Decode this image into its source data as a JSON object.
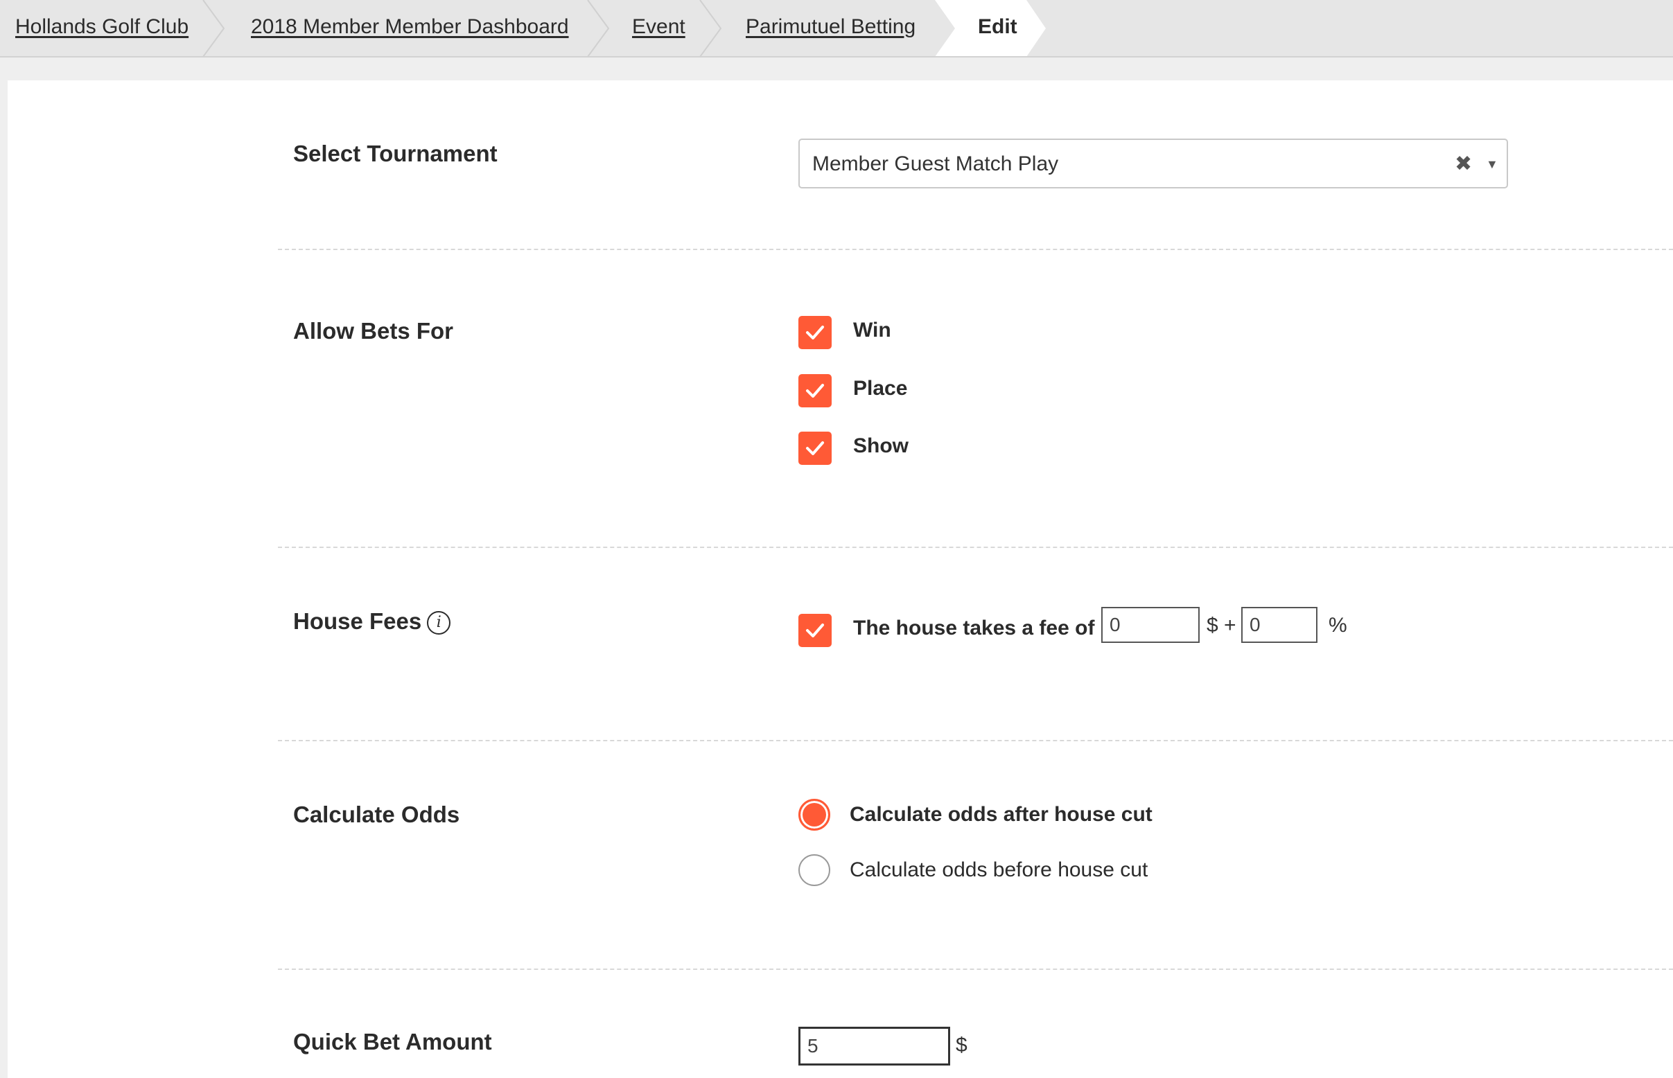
{
  "breadcrumb": {
    "items": [
      "Hollands Golf Club",
      "2018 Member Member Dashboard",
      "Event",
      "Parimutuel Betting"
    ],
    "active": "Edit"
  },
  "tournament": {
    "label": "Select Tournament",
    "value": "Member Guest Match Play",
    "clear": "✖",
    "caret": "▼"
  },
  "bets": {
    "label": "Allow Bets For",
    "options": [
      {
        "label": "Win",
        "checked": true
      },
      {
        "label": "Place",
        "checked": true
      },
      {
        "label": "Show",
        "checked": true
      }
    ]
  },
  "house_fees": {
    "label": "House Fees",
    "info": "i",
    "checked": true,
    "text": "The house takes a fee of",
    "fixed_value": "0",
    "fixed_unit": "$ +",
    "percent_value": "0",
    "percent_unit": "%"
  },
  "odds": {
    "label": "Calculate Odds",
    "options": [
      {
        "label": "Calculate odds after house cut",
        "selected": true
      },
      {
        "label": "Calculate odds before house cut",
        "selected": false
      }
    ]
  },
  "quick_bet": {
    "label": "Quick Bet Amount",
    "value": "5",
    "unit": "$"
  },
  "colors": {
    "accent": "#ff5a36"
  }
}
